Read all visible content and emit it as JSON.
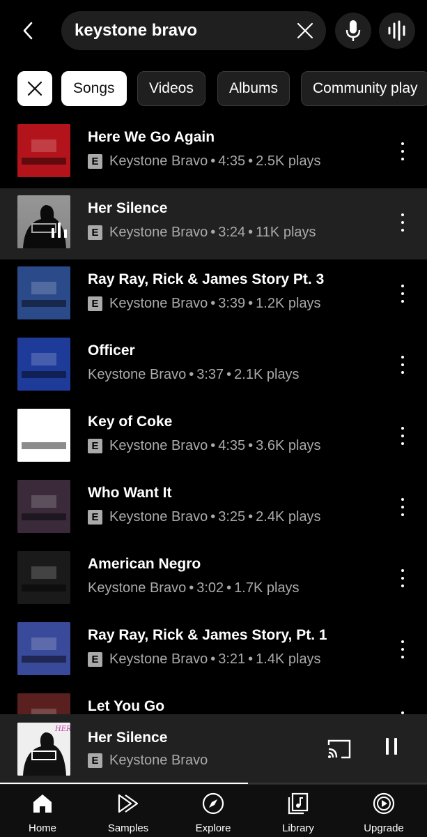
{
  "search": {
    "query": "keystone bravo"
  },
  "filters": [
    "Songs",
    "Videos",
    "Albums",
    "Community play"
  ],
  "songs": [
    {
      "title": "Here We Go Again",
      "artist": "Keystone Bravo",
      "duration": "4:35",
      "plays": "2.5K plays",
      "explicit": true,
      "thumb_color": "#b3141b"
    },
    {
      "title": "Her Silence",
      "artist": "Keystone Bravo",
      "duration": "3:24",
      "plays": "11K plays",
      "explicit": true,
      "playing": true,
      "thumb_color": "#e8e8e8"
    },
    {
      "title": "Ray Ray, Rick & James Story Pt. 3",
      "artist": "Keystone Bravo",
      "duration": "3:39",
      "plays": "1.2K plays",
      "explicit": true,
      "thumb_color": "#2b4a8a"
    },
    {
      "title": "Officer",
      "artist": "Keystone Bravo",
      "duration": "3:37",
      "plays": "2.1K plays",
      "explicit": false,
      "thumb_color": "#1f3b9a"
    },
    {
      "title": "Key of Coke",
      "artist": "Keystone Bravo",
      "duration": "4:35",
      "plays": "3.6K plays",
      "explicit": true,
      "thumb_color": "#ffffff"
    },
    {
      "title": "Who Want It",
      "artist": "Keystone Bravo",
      "duration": "3:25",
      "plays": "2.4K plays",
      "explicit": true,
      "thumb_color": "#3a2a3a"
    },
    {
      "title": "American Negro",
      "artist": "Keystone Bravo",
      "duration": "3:02",
      "plays": "1.7K plays",
      "explicit": false,
      "thumb_color": "#1a1a1a"
    },
    {
      "title": "Ray Ray, Rick & James Story, Pt. 1",
      "artist": "Keystone Bravo",
      "duration": "3:21",
      "plays": "1.4K plays",
      "explicit": true,
      "thumb_color": "#3a4a9a"
    },
    {
      "title": "Let You Go",
      "artist": "",
      "duration": "",
      "plays": "",
      "explicit": false,
      "thumb_color": "#5a2020"
    }
  ],
  "now_playing": {
    "title": "Her Silence",
    "artist": "Keystone Bravo",
    "explicit": true,
    "progress": 0.58
  },
  "nav": [
    "Home",
    "Samples",
    "Explore",
    "Library",
    "Upgrade"
  ],
  "icons": {
    "back": "arrow-left-icon",
    "clear": "close-icon",
    "mic": "microphone-icon",
    "song_search": "audio-wave-icon",
    "more": "more-vertical-icon",
    "cast": "cast-icon",
    "pause": "pause-icon"
  },
  "colors": {
    "background": "#000000",
    "surface": "#1f1f1f",
    "active_row": "#212121",
    "secondary_text": "#aaaaaa"
  }
}
